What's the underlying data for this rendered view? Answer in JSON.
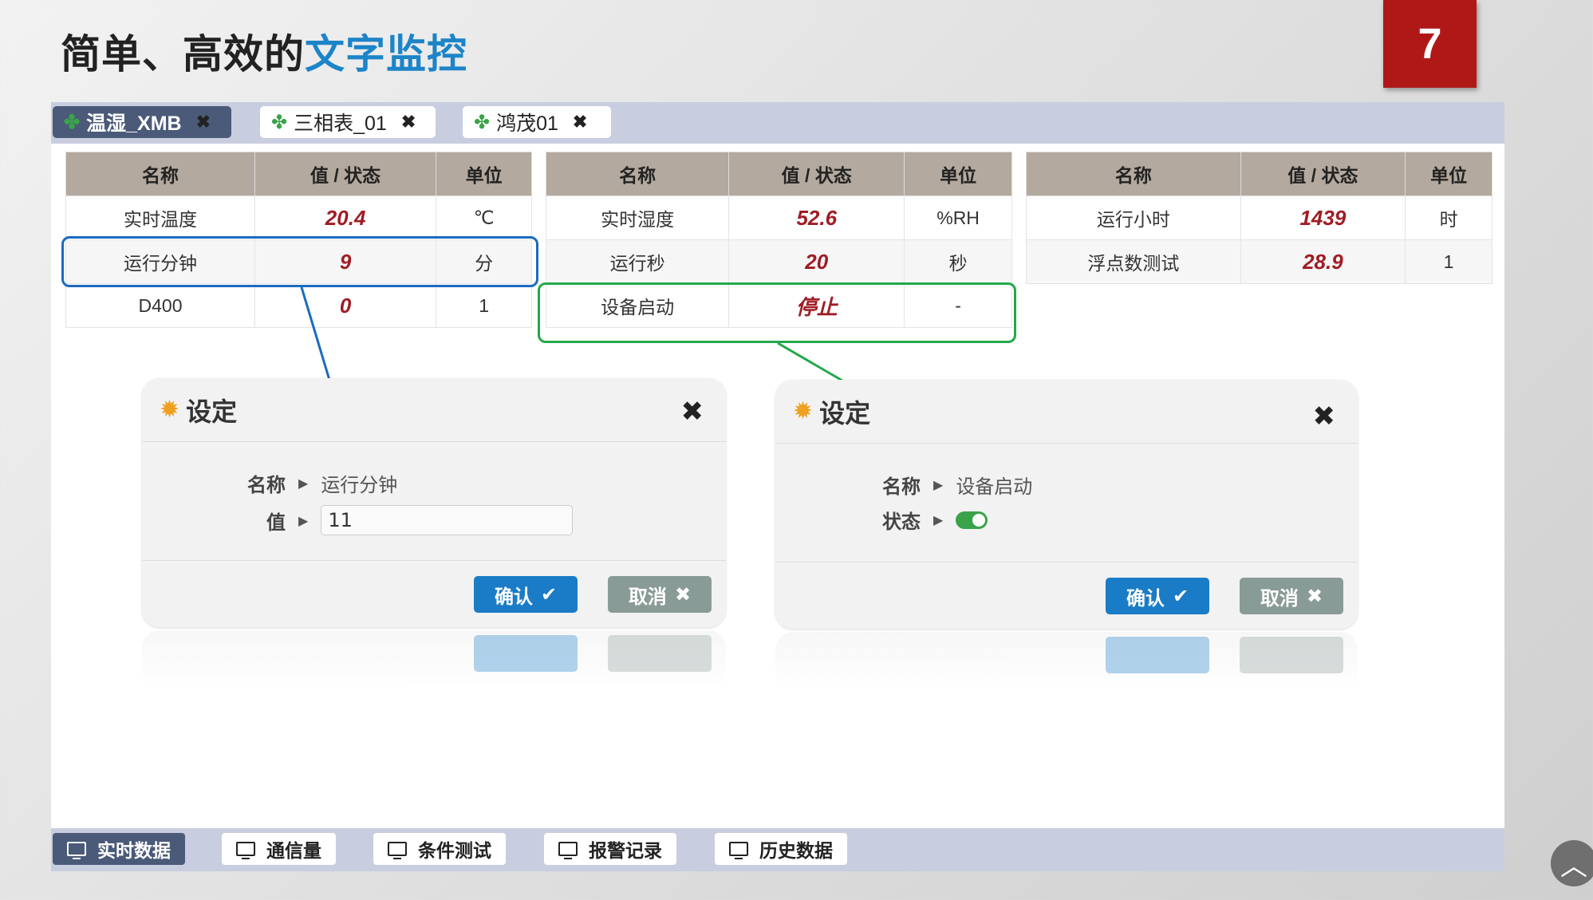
{
  "slide": {
    "title_prefix": "简单、高效的",
    "title_highlight": "文字监控",
    "page_number": "7"
  },
  "tabs": [
    {
      "label": "温湿_XMB",
      "active": true
    },
    {
      "label": "三相表_01",
      "active": false
    },
    {
      "label": "鸿茂01",
      "active": false
    }
  ],
  "tables": {
    "headers": [
      "名称",
      "值 / 状态",
      "单位"
    ],
    "t1": [
      [
        "实时温度",
        "20.4",
        "℃"
      ],
      [
        "运行分钟",
        "9",
        "分"
      ],
      [
        "D400",
        "0",
        "1"
      ]
    ],
    "t2": [
      [
        "实时湿度",
        "52.6",
        "%RH"
      ],
      [
        "运行秒",
        "20",
        "秒"
      ],
      [
        "设备启动",
        "停止",
        "-"
      ]
    ],
    "t3": [
      [
        "运行小时",
        "1439",
        "时"
      ],
      [
        "浮点数测试",
        "28.9",
        "1"
      ]
    ]
  },
  "dialog_left": {
    "title": "设定",
    "name_label": "名称",
    "name_value": "运行分钟",
    "value_label": "值",
    "value_input": "11",
    "ok_label": "确认",
    "cancel_label": "取消"
  },
  "dialog_right": {
    "title": "设定",
    "name_label": "名称",
    "name_value": "设备启动",
    "state_label": "状态",
    "state_on": true,
    "ok_label": "确认",
    "cancel_label": "取消"
  },
  "bottom_tabs": [
    {
      "label": "实时数据",
      "active": true
    },
    {
      "label": "通信量",
      "active": false
    },
    {
      "label": "条件测试",
      "active": false
    },
    {
      "label": "报警记录",
      "active": false
    },
    {
      "label": "历史数据",
      "active": false
    }
  ],
  "colors": {
    "accent": "#1c84c8",
    "page_badge": "#b01818",
    "value_red": "#a01c24",
    "highlight_blue": "#1a6bbf",
    "highlight_green": "#22a84a"
  }
}
